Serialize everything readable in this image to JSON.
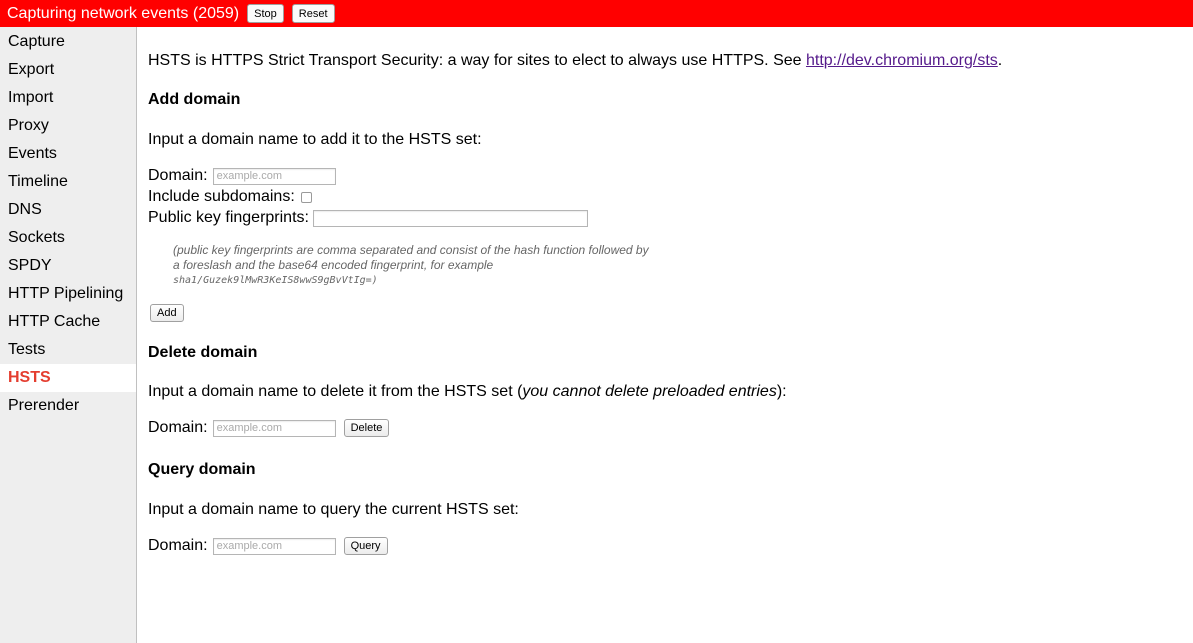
{
  "topbar": {
    "title": "Capturing network events (2059)",
    "stop_label": "Stop",
    "reset_label": "Reset",
    "bg_color": "#ff0000"
  },
  "sidebar": {
    "items": [
      {
        "label": "Capture"
      },
      {
        "label": "Export"
      },
      {
        "label": "Import"
      },
      {
        "label": "Proxy"
      },
      {
        "label": "Events"
      },
      {
        "label": "Timeline"
      },
      {
        "label": "DNS"
      },
      {
        "label": "Sockets"
      },
      {
        "label": "SPDY"
      },
      {
        "label": "HTTP Pipelining"
      },
      {
        "label": "HTTP Cache"
      },
      {
        "label": "Tests"
      },
      {
        "label": "HSTS",
        "selected": true
      },
      {
        "label": "Prerender"
      }
    ],
    "selected_color": "#e43d2f"
  },
  "main": {
    "intro_text": "HSTS is HTTPS Strict Transport Security: a way for sites to elect to always use HTTPS. See ",
    "intro_link": "http://dev.chromium.org/sts",
    "intro_end": ".",
    "add": {
      "heading": "Add domain",
      "instructions": "Input a domain name to add it to the HSTS set:",
      "domain_label": "Domain:",
      "domain_placeholder": "example.com",
      "subdomains_label": "Include subdomains:",
      "fingerprints_label": "Public key fingerprints:",
      "note_line1": "(public key fingerprints are comma separated and consist of the hash function followed by",
      "note_line2": "a foreslash and the base64 encoded fingerprint, for example",
      "note_line3": "sha1/Guzek9lMwR3KeIS8wwS9gBvVtIg=)",
      "button_label": "Add"
    },
    "delete": {
      "heading": "Delete domain",
      "instructions_pre": "Input a domain name to delete it from the HSTS set (",
      "instructions_em": "you cannot delete preloaded entries",
      "instructions_post": "):",
      "domain_label": "Domain:",
      "domain_placeholder": "example.com",
      "button_label": "Delete"
    },
    "query": {
      "heading": "Query domain",
      "instructions": "Input a domain name to query the current HSTS set:",
      "domain_label": "Domain:",
      "domain_placeholder": "example.com",
      "button_label": "Query"
    }
  }
}
